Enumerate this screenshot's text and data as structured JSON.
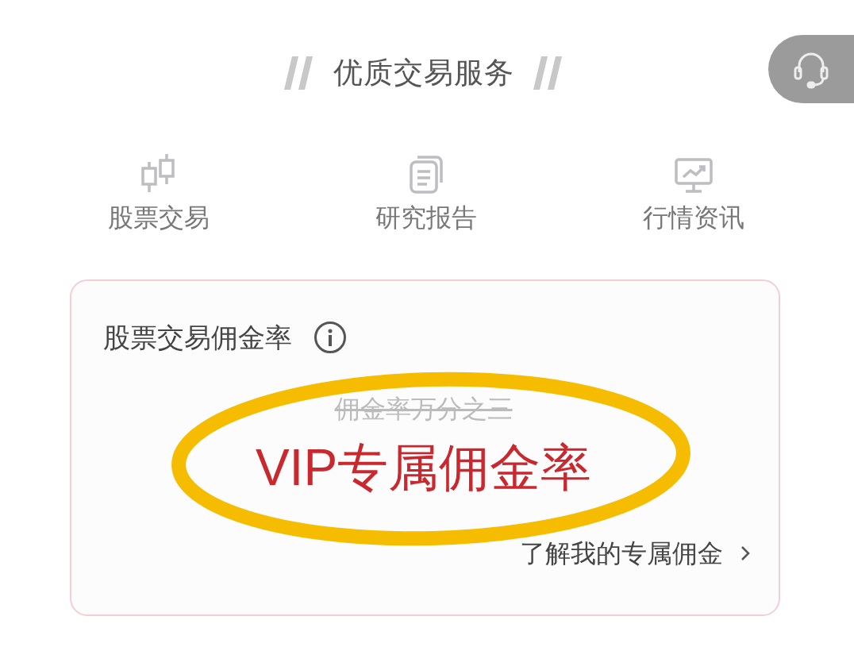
{
  "section_title": "优质交易服务",
  "services": [
    {
      "kind": "candlestick",
      "label": "股票交易"
    },
    {
      "kind": "document",
      "label": "研究报告"
    },
    {
      "kind": "monitor",
      "label": "行情资讯"
    }
  ],
  "card": {
    "title": "股票交易佣金率",
    "old_rate": {
      "text": "佣金率万分之三",
      "struck": true
    },
    "vip_rate": "VIP专属佣金率",
    "link": "了解我的专属佣金",
    "highlighted": true
  }
}
